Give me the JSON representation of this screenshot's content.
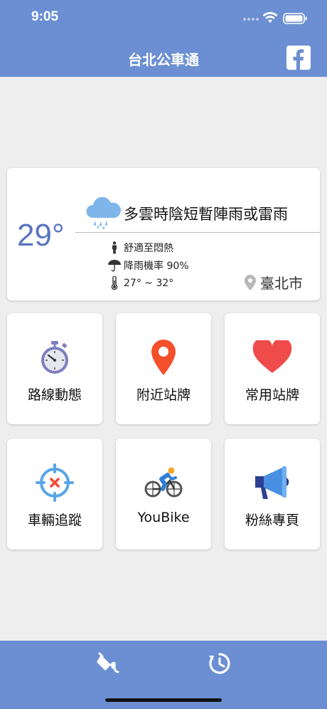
{
  "status_bar": {
    "time": "9:05"
  },
  "header": {
    "title": "台北公車通",
    "facebook_letter": "f"
  },
  "weather": {
    "temperature": "29°",
    "description": "多雲時陰短暫陣雨或雷雨",
    "comfort": "舒適至悶熱",
    "rain_chance": "降雨機率 90%",
    "temp_range": "27° ~ 32°",
    "city": "臺北市"
  },
  "tiles": [
    {
      "label": "路線動態",
      "icon": "stopwatch-icon"
    },
    {
      "label": "附近站牌",
      "icon": "map-pin-icon"
    },
    {
      "label": "常用站牌",
      "icon": "heart-icon"
    },
    {
      "label": "車輛追蹤",
      "icon": "crosshair-icon"
    },
    {
      "label": "YouBike",
      "icon": "cyclist-icon"
    },
    {
      "label": "粉絲專頁",
      "icon": "megaphone-icon"
    }
  ],
  "colors": {
    "primary": "#6b8fd2",
    "temperature": "#5876bf",
    "background": "#eeeeee"
  }
}
